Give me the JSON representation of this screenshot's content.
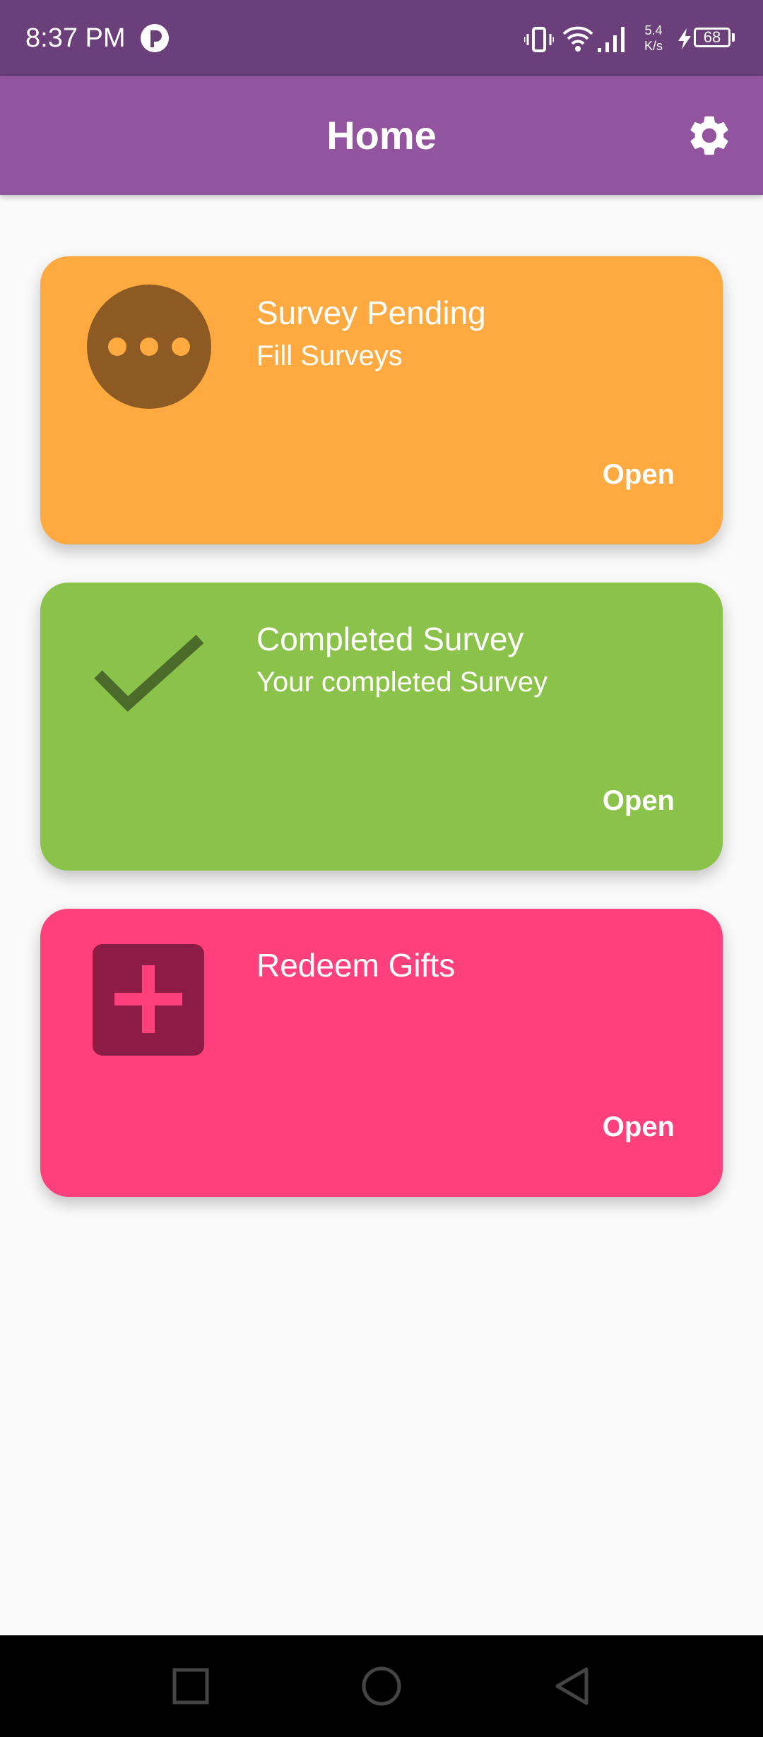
{
  "status_bar": {
    "time": "8:37 PM",
    "net_speed_value": "5.4",
    "net_speed_unit": "K/s",
    "battery_level": "68",
    "icons": [
      "app-notification-icon",
      "vibrate-icon",
      "wifi-icon",
      "signal-icon",
      "charging-icon",
      "battery-icon"
    ]
  },
  "app_bar": {
    "title": "Home",
    "settings_icon": "gear-icon"
  },
  "cards": [
    {
      "title": "Survey Pending",
      "subtitle": "Fill Surveys",
      "action": "Open",
      "icon": "more-horizontal-icon",
      "color": "#ffaa40"
    },
    {
      "title": "Completed Survey",
      "subtitle": "Your completed Survey",
      "action": "Open",
      "icon": "check-icon",
      "color": "#8bc24a"
    },
    {
      "title": "Redeem Gifts",
      "subtitle": "",
      "action": "Open",
      "icon": "add-box-icon",
      "color": "#ff407d"
    }
  ],
  "nav_bar": {
    "buttons": [
      "recents-square-icon",
      "home-circle-icon",
      "back-triangle-icon"
    ]
  },
  "colors": {
    "status_bar": "#6b3f7a",
    "app_bar": "#92549e",
    "background": "#fafafa"
  }
}
